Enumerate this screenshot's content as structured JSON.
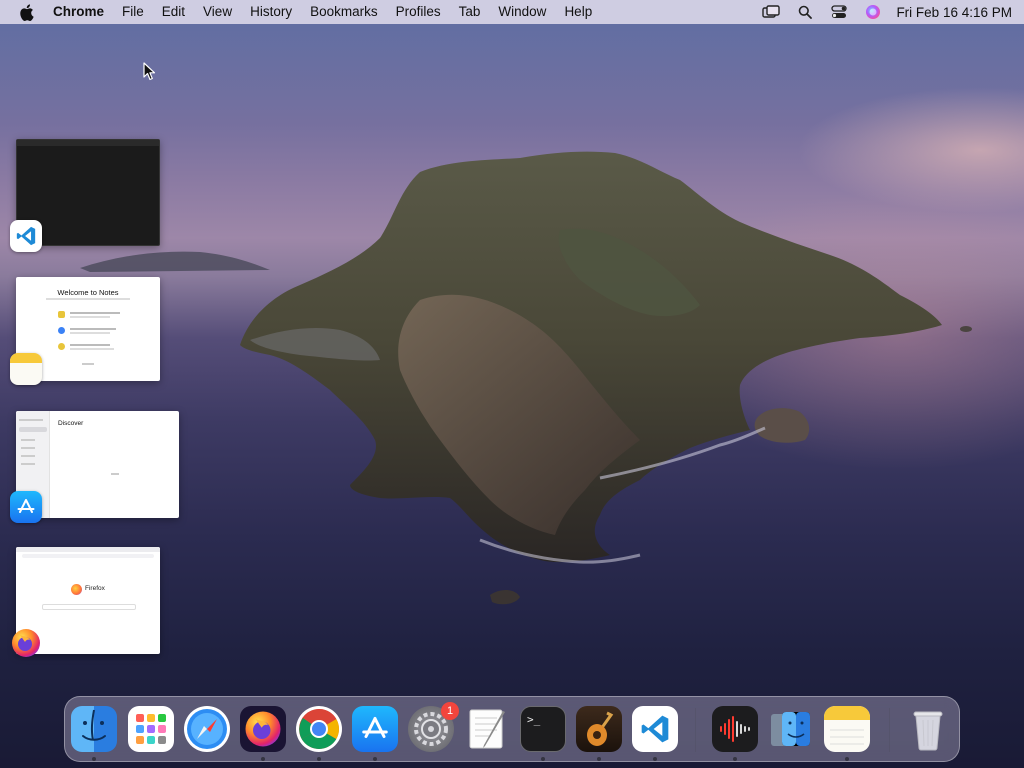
{
  "menubar": {
    "app_name": "Chrome",
    "items": [
      "File",
      "Edit",
      "View",
      "History",
      "Bookmarks",
      "Profiles",
      "Tab",
      "Window",
      "Help"
    ],
    "clock": "Fri Feb 16  4:16 PM",
    "status_icons": [
      "screen-mirroring-icon",
      "search-icon",
      "control-center-icon",
      "siri-icon"
    ]
  },
  "app_switcher": [
    {
      "app": "Visual Studio Code",
      "icon": "vscode-icon"
    },
    {
      "app": "Notes",
      "icon": "notes-icon",
      "thumb_title": "Welcome to Notes"
    },
    {
      "app": "App Store",
      "icon": "app-store-icon",
      "thumb_title": "Discover"
    },
    {
      "app": "Firefox",
      "icon": "firefox-icon",
      "thumb_title": "Firefox"
    }
  ],
  "dock": {
    "apps": [
      {
        "name": "Finder",
        "icon": "finder-icon",
        "running": true
      },
      {
        "name": "Launchpad",
        "icon": "launchpad-icon",
        "running": false
      },
      {
        "name": "Safari",
        "icon": "safari-icon",
        "running": false
      },
      {
        "name": "Firefox",
        "icon": "firefox-icon",
        "running": true
      },
      {
        "name": "Google Chrome",
        "icon": "chrome-icon",
        "running": true
      },
      {
        "name": "App Store",
        "icon": "app-store-icon",
        "running": true
      },
      {
        "name": "System Preferences",
        "icon": "system-preferences-icon",
        "running": false,
        "badge": "1"
      },
      {
        "name": "TextEdit",
        "icon": "textedit-icon",
        "running": false
      },
      {
        "name": "Terminal",
        "icon": "terminal-icon",
        "running": true
      },
      {
        "name": "GarageBand",
        "icon": "garageband-icon",
        "running": true
      },
      {
        "name": "Visual Studio Code",
        "icon": "vscode-icon",
        "running": true
      },
      {
        "name": "Voice Memos",
        "icon": "voice-memos-icon",
        "running": true
      },
      {
        "name": "Finder",
        "icon": "finder-folder-icon",
        "running": false
      },
      {
        "name": "Notes",
        "icon": "notes-icon",
        "running": true
      },
      {
        "name": "Trash",
        "icon": "trash-icon",
        "running": false
      }
    ]
  }
}
